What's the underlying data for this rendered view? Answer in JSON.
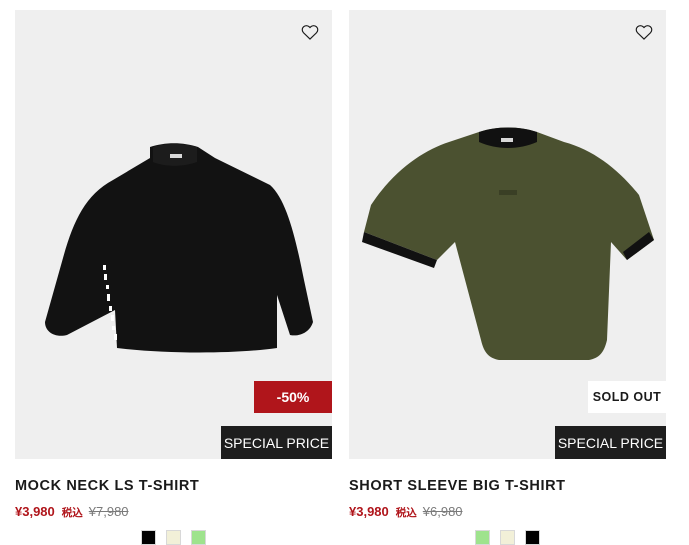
{
  "products": [
    {
      "name": "MOCK NECK LS T-SHIRT",
      "price": "¥3,980",
      "tax_label": "税込",
      "original_price": "¥7,980",
      "discount_badge": "-50%",
      "special_badge": "SPECIAL PRICE",
      "favorite_icon": "heart-outline-icon",
      "swatches": [
        "#000000",
        "#f2f0d8",
        "#9ee38d"
      ],
      "colors": {
        "garment": "#121212",
        "accent": "#ffffff"
      }
    },
    {
      "name": "SHORT SLEEVE BIG T-SHIRT",
      "price": "¥3,980",
      "tax_label": "税込",
      "original_price": "¥6,980",
      "status_badge": "SOLD OUT",
      "special_badge": "SPECIAL PRICE",
      "favorite_icon": "heart-outline-icon",
      "swatches": [
        "#9ee38d",
        "#f2f0d8",
        "#000000"
      ],
      "colors": {
        "garment": "#4b5130",
        "accent": "#111111"
      }
    }
  ],
  "colors": {
    "sale_red": "#b0151b",
    "badge_dark": "#1e1e1e",
    "image_bg": "#efefef"
  }
}
